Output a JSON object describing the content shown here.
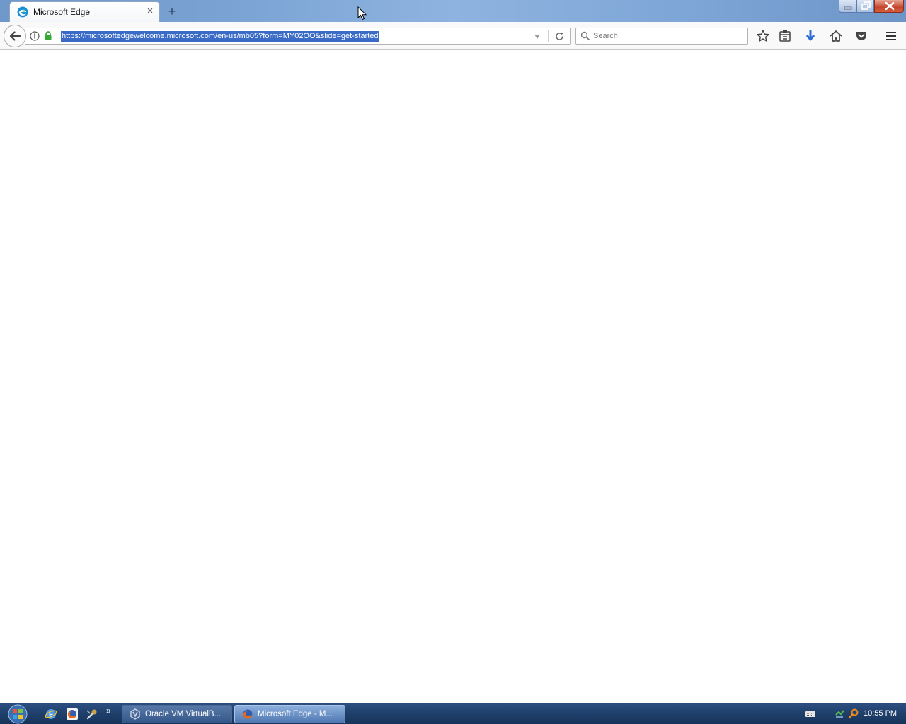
{
  "browser": {
    "tab": {
      "title": "Microsoft Edge",
      "favicon": "edge-icon",
      "close_glyph": "×"
    },
    "new_tab_glyph": "+",
    "window_controls": [
      "minimize",
      "maximize",
      "close"
    ],
    "address_bar": {
      "url": "https://microsoftedgewelcome.microsoft.com/en-us/mb05?form=MY02OO&slide=get-started",
      "selected": true,
      "icons": [
        "info-icon",
        "lock-icon",
        "dropdown-arrow-icon",
        "reload-icon"
      ]
    },
    "search_bar": {
      "placeholder": "Search",
      "value": ""
    },
    "toolbar_icons": [
      "bookmark-star-icon",
      "reading-list-icon",
      "download-icon",
      "home-icon",
      "pocket-icon",
      "hamburger-menu-icon"
    ]
  },
  "taskbar": {
    "quick_launch": [
      "ie-icon",
      "firefox-icon",
      "tool-icon"
    ],
    "more_glyph": "»",
    "buttons": [
      {
        "label": "Oracle VM VirtualB...",
        "icon": "virtualbox-icon",
        "active": false
      },
      {
        "label": "Microsoft Edge - M...",
        "icon": "firefox-icon",
        "active": true
      }
    ],
    "tray_icons": [
      "keyboard-icon",
      "network-icon",
      "search-icon"
    ],
    "clock": "10:55 PM"
  },
  "colors": {
    "url_selection": "#3a6bc6",
    "taskbar": "#1f3f6b",
    "titlebar": "#7aa3d3"
  }
}
